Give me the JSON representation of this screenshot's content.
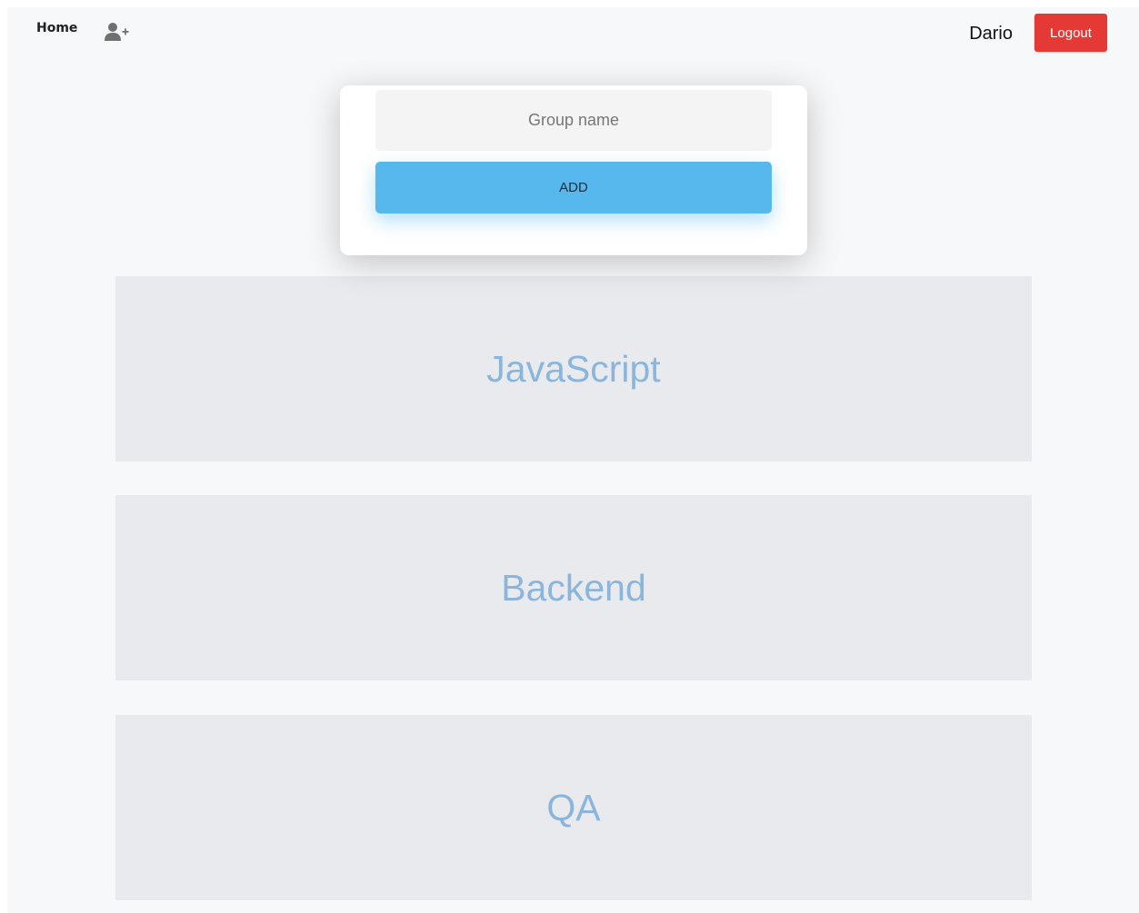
{
  "nav": {
    "home_label": "Home",
    "add_user_icon": "user-plus-icon"
  },
  "user": {
    "name": "Dario",
    "logout_label": "Logout"
  },
  "form": {
    "group_input": {
      "placeholder": "Group name",
      "value": ""
    },
    "add_label": "ADD"
  },
  "groups": [
    {
      "name": "JavaScript"
    },
    {
      "name": "Backend"
    },
    {
      "name": "QA"
    }
  ],
  "colors": {
    "page_background": "#f7f8fa",
    "logout_button": "#e53935",
    "add_button": "#56b8ec",
    "group_card_background": "#e8eaed",
    "group_card_text": "#8ab6dd"
  }
}
